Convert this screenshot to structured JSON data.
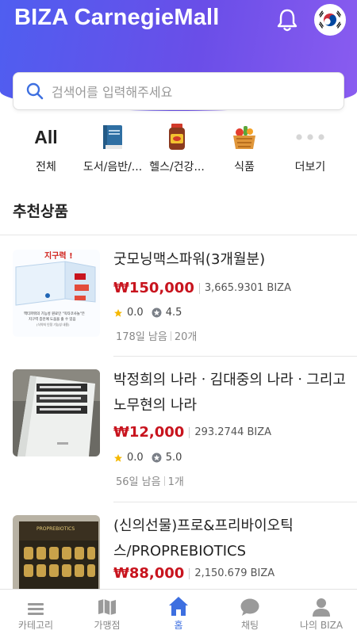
{
  "header": {
    "title": "BIZA CarnegieMall",
    "bell_icon": "bell-icon",
    "flag_icon": "korea-flag-icon"
  },
  "search": {
    "placeholder": "검색어를 입력해주세요",
    "icon": "search-icon"
  },
  "categories": [
    {
      "icon_text": "All",
      "label": "전체"
    },
    {
      "icon": "book-icon",
      "label": "도서/음반/..."
    },
    {
      "icon": "supplement-icon",
      "label": "헬스/건강..."
    },
    {
      "icon": "grocery-basket-icon",
      "label": "식품"
    },
    {
      "icon": "more-dots-icon",
      "label": "더보기"
    }
  ],
  "section_title": "추천상품",
  "products": [
    {
      "name": "굿모닝맥스파워(3개월분)",
      "price": "₩150,000",
      "biza": "3,665.9301 BIZA",
      "star_rating": "0.0",
      "badge_rating": "4.5",
      "days_left": "178일 남음",
      "count": "20개",
      "thumb_text": "지구력 !",
      "thumb_caption_1": "액티파워의 기능성 원료인 \"옥타코사놀\"은",
      "thumb_caption_2": "지구력 증진에 도움을 줄 수 있음",
      "thumb_caption_3": "(식약처 인정 기능성 내용)"
    },
    {
      "name": "박정희의 나라ㆍ김대중의 나라ㆍ그리고 노무현의 나라",
      "price": "₩12,000",
      "biza": "293.2744 BIZA",
      "star_rating": "0.0",
      "badge_rating": "5.0",
      "days_left": "56일 남음",
      "count": "1개"
    },
    {
      "name": "(신의선물)프로&프리바이오틱스/PROPREBIOTICS",
      "price": "₩88,000",
      "biza": "2,150.679 BIZA",
      "thumb_text": "PROPREBIOTICS"
    }
  ],
  "tabs": [
    {
      "label": "카테고리",
      "icon": "menu-icon",
      "active": false
    },
    {
      "label": "가맹점",
      "icon": "map-icon",
      "active": false
    },
    {
      "label": "홈",
      "icon": "home-icon",
      "active": true
    },
    {
      "label": "채팅",
      "icon": "chat-icon",
      "active": false
    },
    {
      "label": "나의 BIZA",
      "icon": "user-icon",
      "active": false
    }
  ],
  "colors": {
    "accent": "#3d6fe0",
    "price": "#c8141e",
    "header_start": "#4f5ef0",
    "header_end": "#8a5cf0"
  }
}
